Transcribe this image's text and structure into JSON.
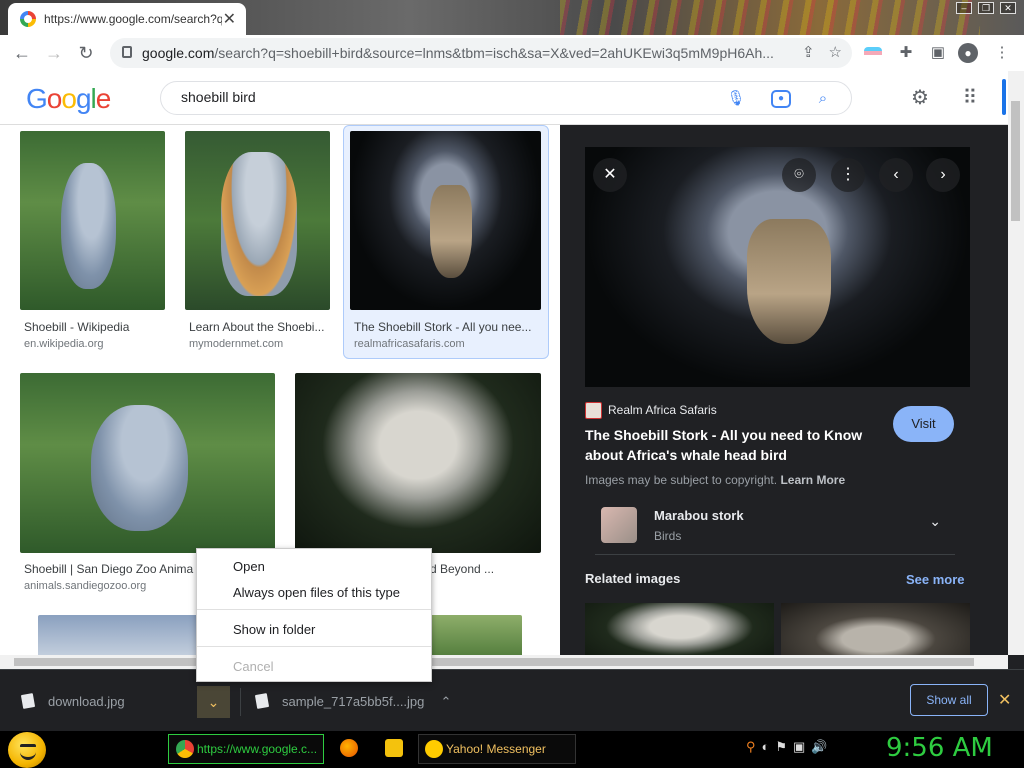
{
  "tab": {
    "title": "https://www.google.com/search?q=shoebill+bird"
  },
  "omnibox": {
    "domain": "google.com",
    "path": "/search?q=shoebill+bird&source=lnms&tbm=isch&sa=X&ved=2ahUKEwi3q5mM9pH6Ah..."
  },
  "google": {
    "logo": [
      "G",
      "o",
      "o",
      "g",
      "l",
      "e"
    ],
    "query": "shoebill bird"
  },
  "results": [
    {
      "title": "Shoebill - Wikipedia",
      "source": "en.wikipedia.org"
    },
    {
      "title": "Learn About the Shoebi...",
      "source": "mymodernmet.com"
    },
    {
      "title": "The Shoebill Stork - All you nee...",
      "source": "realmafricasafaris.com"
    },
    {
      "title": "Shoebill | San Diego Zoo Anima",
      "source": "animals.sandiegozoo.org"
    },
    {
      "title": "d Beyond ..."
    }
  ],
  "preview": {
    "site": "Realm Africa Safaris",
    "title": "The Shoebill Stork - All you need to Know about Africa's whale head bird",
    "visit": "Visit",
    "copyright": "Images may be subject to copyright.",
    "learn_more": "Learn More",
    "kp_name": "Marabou stork",
    "kp_sub": "Birds",
    "related": "Related images",
    "see_more": "See more"
  },
  "context_menu": {
    "items": [
      "Open",
      "Always open files of this type",
      "Show in folder",
      "Cancel"
    ]
  },
  "downloads": {
    "items": [
      "download.jpg",
      "sample_717a5bb5f....jpg"
    ],
    "show_all": "Show all"
  },
  "taskbar": {
    "tasks": [
      "https://www.google.c...",
      "Yahoo! Messenger"
    ],
    "clock": "9:56 AM"
  }
}
